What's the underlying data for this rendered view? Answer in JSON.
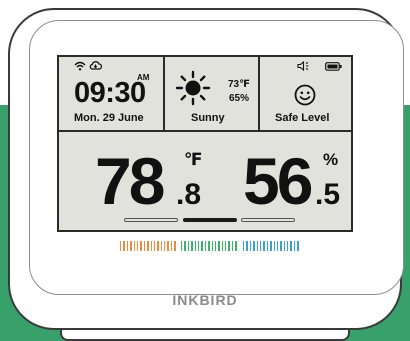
{
  "brand": "INKBIRD",
  "clock": {
    "time": "09:30",
    "ampm": "AM",
    "date": "Mon. 29 June"
  },
  "weather": {
    "condition": "Sunny",
    "outdoor_temp": "73℉",
    "outdoor_humidity": "65%",
    "icon": "sun-icon"
  },
  "status": {
    "comfort": "Safe Level",
    "icon": "smiley-icon",
    "sound_icon": "speaker-icon",
    "battery_icon": "battery-icon"
  },
  "connectivity": {
    "wifi_icon": "wifi-icon",
    "cloud_icon": "cloud-icon"
  },
  "readings": {
    "temperature_int": "78",
    "temperature_dec": ".8",
    "temperature_unit": "℉",
    "humidity_int": "56",
    "humidity_dec": ".5",
    "humidity_unit": "%"
  },
  "pager": {
    "pages": 3,
    "active": 2
  },
  "colors": {
    "background_green": "#37a06b",
    "bar_orange": "#f08a3c",
    "bar_green": "#3bb36a",
    "bar_blue": "#3aa0d8"
  }
}
